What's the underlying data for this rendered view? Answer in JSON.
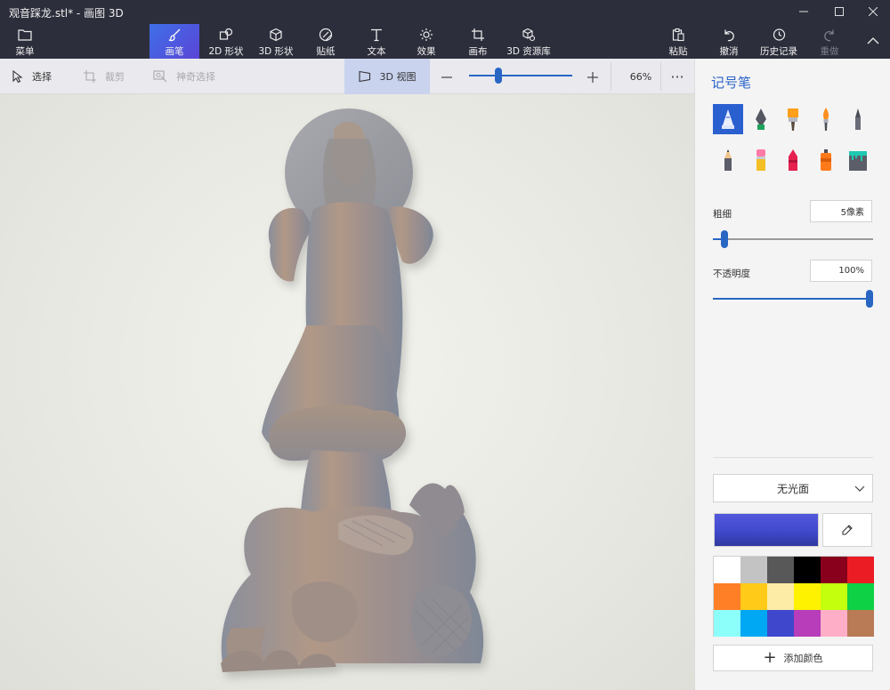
{
  "window": {
    "title": "观音踩龙.stl* - 画图 3D"
  },
  "ribbon": {
    "menu": "菜单",
    "brushes": "画笔",
    "shapes2d": "2D 形状",
    "shapes3d": "3D 形状",
    "stickers": "贴纸",
    "text": "文本",
    "effects": "效果",
    "canvas": "画布",
    "library3d": "3D 资源库",
    "paste": "粘贴",
    "undo": "撤消",
    "history": "历史记录",
    "redo": "重做"
  },
  "toolbar": {
    "select": "选择",
    "crop": "裁剪",
    "magic_select": "神奇选择",
    "view3d": "3D 视图",
    "zoom_percent": "66%",
    "more": "···"
  },
  "zoom": {
    "level": 0.27
  },
  "panel": {
    "title": "记号笔",
    "thickness_label": "粗细",
    "thickness_value": "5像素",
    "thickness_level": 0.05,
    "opacity_label": "不透明度",
    "opacity_value": "100%",
    "opacity_level": 1.0,
    "finish": "无光面",
    "add_color": "添加颜色",
    "current_color": "#4048cc",
    "swatches": [
      "#ffffff",
      "#c3c3c3",
      "#585858",
      "#000000",
      "#88001b",
      "#ec1c24",
      "#ff7f27",
      "#ffca18",
      "#fdeca6",
      "#fff200",
      "#c4ff0e",
      "#0ed145",
      "#8cfffb",
      "#00a8f3",
      "#3f48cc",
      "#b83dba",
      "#ffaec8",
      "#b97a56"
    ]
  },
  "colors": {
    "accent": "#2966c4",
    "ribbon_bg": "#2c2e3b"
  }
}
